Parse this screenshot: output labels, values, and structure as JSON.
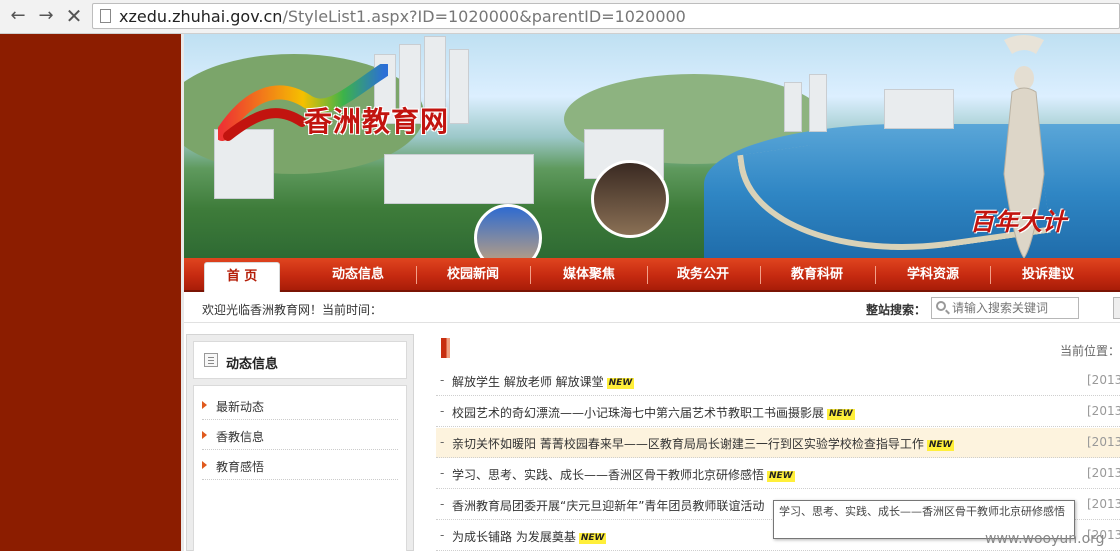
{
  "browser": {
    "url_host": "xzedu.zhuhai.gov.cn",
    "url_path": "/StyleList1.aspx?ID=1020000&parentID=1020000",
    "back_icon": "←",
    "forward_icon": "→",
    "stop_icon": "✕"
  },
  "banner": {
    "site_title": "香洲教育网",
    "slogan": "百年大计"
  },
  "nav": {
    "items": [
      {
        "label": "首 页"
      },
      {
        "label": "动态信息"
      },
      {
        "label": "校园新闻"
      },
      {
        "label": "媒体聚焦"
      },
      {
        "label": "政务公开"
      },
      {
        "label": "教育科研"
      },
      {
        "label": "学科资源"
      },
      {
        "label": "投诉建议"
      }
    ]
  },
  "welcome": {
    "text": "欢迎光临香洲教育网！当前时间：",
    "search_label": "整站搜索：",
    "search_placeholder": "请输入搜索关键词"
  },
  "sidebar": {
    "title": "动态信息",
    "items": [
      {
        "label": "最新动态"
      },
      {
        "label": "香教信息"
      },
      {
        "label": "教育感悟"
      }
    ]
  },
  "main": {
    "breadcrumb": "当前位置：",
    "new_badge": "NEW",
    "news": [
      {
        "title": "解放学生 解放老师 解放课堂",
        "date": "[2013-"
      },
      {
        "title": "校园艺术的奇幻漂流——小记珠海七中第六届艺术节教职工书画摄影展",
        "date": "[2013-"
      },
      {
        "title": "亲切关怀如暖阳 菁菁校园春来早——区教育局局长谢建三一行到区实验学校检查指导工作",
        "date": "[2013-"
      },
      {
        "title": "学习、思考、实践、成长——香洲区骨干教师北京研修感悟",
        "date": "[2013-"
      },
      {
        "title": "香洲教育局团委开展“庆元旦迎新年”青年团员教师联谊活动",
        "date": "[2013-"
      },
      {
        "title": "为成长铺路 为发展奠基",
        "date": "[2013-"
      }
    ],
    "tooltip": "学习、思考、实践、成长——香洲区骨干教师北京研修感悟"
  },
  "watermark": "www.wooyun.org"
}
